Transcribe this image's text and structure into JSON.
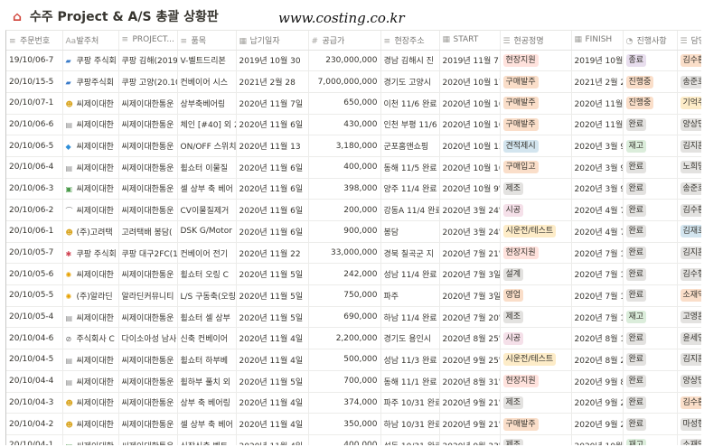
{
  "header": {
    "title": "수주 Project & A/S 총괄 상황판",
    "watermark": "www.costing.co.kr"
  },
  "columns": [
    {
      "label": "주문번호",
      "icon": "≡"
    },
    {
      "label": "발주처",
      "icon": "Aa"
    },
    {
      "label": "PROJECT...",
      "icon": "≡"
    },
    {
      "label": "품목",
      "icon": "≡"
    },
    {
      "label": "납기일자",
      "icon": "▦"
    },
    {
      "label": "공급가",
      "icon": "#"
    },
    {
      "label": "현장주소",
      "icon": "≡"
    },
    {
      "label": "START",
      "icon": "▦"
    },
    {
      "label": "현공정명",
      "icon": "☰"
    },
    {
      "label": "FINISH",
      "icon": "▦"
    },
    {
      "label": "진행사항",
      "icon": "◔"
    },
    {
      "label": "담당자",
      "icon": "☰"
    }
  ],
  "tag_colors": {
    "purple": "#e8deee",
    "orange": "#fadec9",
    "green": "#dbeddb",
    "gray": "#e3e2e0",
    "yellow": "#fdecc8",
    "red": "#ffe2dd",
    "blue": "#d3e5ef",
    "brown": "#eee0da",
    "pink": "#f5e0e9"
  },
  "rows": [
    {
      "order": "19/10/06-7",
      "client_icon": "car-icon",
      "client": "쿠팡 주식회",
      "project": "쿠팡 김해(2019",
      "item": "V-벨트드리본",
      "due": "2019년 10월 30",
      "price": "230,000,000",
      "site": "경남 김해시 진",
      "start": "2019년 11월 7",
      "process": {
        "text": "현장지원",
        "color": "red"
      },
      "finish": "2019년 10월 30",
      "status": {
        "text": "종료",
        "color": "purple"
      },
      "manager": {
        "text": "김수환",
        "color": "orange"
      }
    },
    {
      "order": "20/10/15-5",
      "client_icon": "car-icon",
      "client": "쿠팡주식회",
      "project": "쿠팡 고양(20.10",
      "item": "컨베이어 시스",
      "due": "2021년 2월 28",
      "price": "7,000,000,000",
      "site": "경기도 고양시",
      "start": "2020년 10월 17",
      "process": {
        "text": "구매발주",
        "color": "orange"
      },
      "finish": "2021년 2월 28",
      "status": {
        "text": "진행중",
        "color": "orange"
      },
      "manager": {
        "text": "송준호",
        "color": "gray"
      }
    },
    {
      "order": "20/10/07-1",
      "client_icon": "face-icon",
      "client": "씨제이대한",
      "project": "씨제이대한통운",
      "item": "상부축베어링",
      "due": "2020년 11월 7일",
      "price": "650,000",
      "site": "이천 11/6 완료",
      "start": "2020년 10월 10",
      "process": {
        "text": "구매발주",
        "color": "orange"
      },
      "finish": "2020년 11월 5",
      "status": {
        "text": "진행중",
        "color": "orange"
      },
      "manager": {
        "text": "기억주",
        "color": "yellow"
      }
    },
    {
      "order": "20/10/06-6",
      "client_icon": "box-icon",
      "client": "씨제이대한",
      "project": "씨제이대한통운",
      "item": "체인 [#40] 외 2",
      "due": "2020년 11월 6일",
      "price": "430,000",
      "site": "인천 부평 11/6",
      "start": "2020년 10월 10",
      "process": {
        "text": "구매발주",
        "color": "orange"
      },
      "finish": "2020년 11월 5",
      "status": {
        "text": "완료",
        "color": "gray"
      },
      "manager": {
        "text": "양상민",
        "color": "gray"
      }
    },
    {
      "order": "20/10/06-5",
      "client_icon": "diamond-icon",
      "client": "씨제이대한",
      "project": "씨제이대한통운",
      "item": "ON/OFF 스위치",
      "due": "2020년 11월 13",
      "price": "3,180,000",
      "site": "군포홈앤쇼핑",
      "start": "2020년 10월 13",
      "process": {
        "text": "견적제시",
        "color": "blue"
      },
      "finish": "2020년 3월 9일",
      "status": {
        "text": "재고",
        "color": "green"
      },
      "manager": {
        "text": "김지훈",
        "color": "gray"
      }
    },
    {
      "order": "20/10/06-4",
      "client_icon": "box-icon",
      "client": "씨제이대한",
      "project": "씨제이대한통운",
      "item": "휠쇼터 이물질",
      "due": "2020년 11월 6일",
      "price": "400,000",
      "site": "동해 11/5 완료",
      "start": "2020년 10월 10",
      "process": {
        "text": "구매입고",
        "color": "orange"
      },
      "finish": "2020년 3월 9일",
      "status": {
        "text": "완료",
        "color": "gray"
      },
      "manager": {
        "text": "노희명",
        "color": "gray"
      }
    },
    {
      "order": "20/10/06-3",
      "client_icon": "photo-icon",
      "client": "씨제이대한",
      "project": "씨제이대한통운",
      "item": "셀 상부 축 베어",
      "due": "2020년 11월 6일",
      "price": "398,000",
      "site": "양주 11/4 완료",
      "start": "2020년 10월 9일",
      "process": {
        "text": "제조",
        "color": "gray"
      },
      "finish": "2020년 3월 9일",
      "status": {
        "text": "완료",
        "color": "gray"
      },
      "manager": {
        "text": "송준호",
        "color": "gray"
      }
    },
    {
      "order": "20/10/06-2",
      "client_icon": "paperclip-icon",
      "client": "씨제이대한",
      "project": "씨제이대한통운",
      "item": "CV이물질제거",
      "due": "2020년 11월 6일",
      "price": "200,000",
      "site": "강동A 11/4 완료",
      "start": "2020년 3월 24일",
      "process": {
        "text": "시공",
        "color": "pink"
      },
      "finish": "2020년 4월 7일",
      "status": {
        "text": "완료",
        "color": "gray"
      },
      "manager": {
        "text": "김수환",
        "color": "gray"
      }
    },
    {
      "order": "20/10/06-1",
      "client_icon": "face-icon",
      "client": "(주)고려택",
      "project": "고려택배 봉담(",
      "item": "DSK G/Motor",
      "due": "2020년 11월 6일",
      "price": "900,000",
      "site": "봉담",
      "start": "2020년 3월 24일",
      "process": {
        "text": "시운전/테스트",
        "color": "yellow"
      },
      "finish": "2020년 4월 7일",
      "status": {
        "text": "완료",
        "color": "gray"
      },
      "manager": {
        "text": "김재호",
        "color": "blue"
      }
    },
    {
      "order": "20/10/05-7",
      "client_icon": "butterfly-icon",
      "client": "쿠팡 주식회",
      "project": "쿠팡 대구2FC(1",
      "item": "컨베이어 전기",
      "due": "2020년 11월 22",
      "price": "33,000,000",
      "site": "경북 칠곡군 지",
      "start": "2020년 7월 21일",
      "process": {
        "text": "현장지원",
        "color": "red"
      },
      "finish": "2020년 7월 14",
      "status": {
        "text": "완료",
        "color": "gray"
      },
      "manager": {
        "text": "김지훈",
        "color": "gray"
      }
    },
    {
      "order": "20/10/05-6",
      "client_icon": "sun-icon",
      "client": "씨제이대한",
      "project": "씨제이대한통운",
      "item": "휠쇼터 오링 C",
      "due": "2020년 11월 5일",
      "price": "242,000",
      "site": "성남 11/4 완료",
      "start": "2020년 7월 3일",
      "process": {
        "text": "설계",
        "color": "gray"
      },
      "finish": "2020년 7월 14",
      "status": {
        "text": "완료",
        "color": "gray"
      },
      "manager": {
        "text": "김수형",
        "color": "gray"
      }
    },
    {
      "order": "20/10/05-5",
      "client_icon": "sun-icon",
      "client": "(주)알라딘",
      "project": "알라딘커뮤니티",
      "item": "L/S 구동축(오링",
      "due": "2020년 11월 5일",
      "price": "750,000",
      "site": "파주",
      "start": "2020년 7월 3일",
      "process": {
        "text": "영업",
        "color": "orange"
      },
      "finish": "2020년 7월 14",
      "status": {
        "text": "완료",
        "color": "gray"
      },
      "manager": {
        "text": "소재억",
        "color": "orange"
      }
    },
    {
      "order": "20/10/05-4",
      "client_icon": "box-icon",
      "client": "씨제이대한",
      "project": "씨제이대한통운",
      "item": "휠쇼터 셀 상부",
      "due": "2020년 11월 5일",
      "price": "690,000",
      "site": "하남 11/4 완료",
      "start": "2020년 7월 20일",
      "process": {
        "text": "제조",
        "color": "gray"
      },
      "finish": "2020년 7월 14",
      "status": {
        "text": "재고",
        "color": "green"
      },
      "manager": {
        "text": "고영훈",
        "color": "gray"
      }
    },
    {
      "order": "20/10/04-6",
      "client_icon": "link-icon",
      "client": "주식회사 C",
      "project": "다이소아성 남사",
      "item": "신축 컨베이어",
      "due": "2020년 11월 4일",
      "price": "2,200,000",
      "site": "경기도 용인시",
      "start": "2020년 8월 25일",
      "process": {
        "text": "시공",
        "color": "pink"
      },
      "finish": "2020년 8월 10",
      "status": {
        "text": "완료",
        "color": "gray"
      },
      "manager": {
        "text": "윤세영",
        "color": "gray"
      }
    },
    {
      "order": "20/10/04-5",
      "client_icon": "box-icon",
      "client": "씨제이대한",
      "project": "씨제이대한통운",
      "item": "휠쇼터 하부베",
      "due": "2020년 11월 4일",
      "price": "500,000",
      "site": "성남 11/3 완료",
      "start": "2020년 9월 25일",
      "process": {
        "text": "시운전/테스트",
        "color": "yellow"
      },
      "finish": "2020년 8월 24",
      "status": {
        "text": "완료",
        "color": "gray"
      },
      "manager": {
        "text": "김지훈",
        "color": "gray"
      }
    },
    {
      "order": "20/10/04-4",
      "client_icon": "box-icon",
      "client": "씨제이대한",
      "project": "씨제이대한통운",
      "item": "휠하부 풀치 외",
      "due": "2020년 11월 5일",
      "price": "700,000",
      "site": "동해 11/1 완료",
      "start": "2020년 8월 31일",
      "process": {
        "text": "현장지원",
        "color": "red"
      },
      "finish": "2020년 9월 8일",
      "status": {
        "text": "완료",
        "color": "gray"
      },
      "manager": {
        "text": "양상민",
        "color": "gray"
      }
    },
    {
      "order": "20/10/04-3",
      "client_icon": "face-icon",
      "client": "씨제이대한",
      "project": "씨제이대한통운",
      "item": "상부 축 베어링",
      "due": "2020년 11월 4일",
      "price": "374,000",
      "site": "파주 10/31 완료",
      "start": "2020년 9월 21일",
      "process": {
        "text": "제조",
        "color": "gray"
      },
      "finish": "2020년 9월 22",
      "status": {
        "text": "완료",
        "color": "gray"
      },
      "manager": {
        "text": "김수환",
        "color": "orange"
      }
    },
    {
      "order": "20/10/04-2",
      "client_icon": "face-icon",
      "client": "씨제이대한",
      "project": "씨제이대한통운",
      "item": "셀 상부 축 베어",
      "due": "2020년 11월 4일",
      "price": "350,000",
      "site": "하남 10/31 완료",
      "start": "2020년 9월 21일",
      "process": {
        "text": "구매발주",
        "color": "orange"
      },
      "finish": "2020년 9월 22",
      "status": {
        "text": "완료",
        "color": "gray"
      },
      "manager": {
        "text": "마성현",
        "color": "gray"
      }
    },
    {
      "order": "20/10/04-1",
      "client_icon": "photo-icon",
      "client": "씨제이대한",
      "project": "씨제이대한통운",
      "item": "신장신축 벨트",
      "due": "2020년 11월 4일",
      "price": "400,000",
      "site": "성동 10/31 완료",
      "start": "2020년 9월 23일",
      "process": {
        "text": "제조",
        "color": "gray"
      },
      "finish": "2020년 10월 17",
      "status": {
        "text": "재고",
        "color": "green"
      },
      "manager": {
        "text": "소재억",
        "color": "gray"
      }
    }
  ]
}
